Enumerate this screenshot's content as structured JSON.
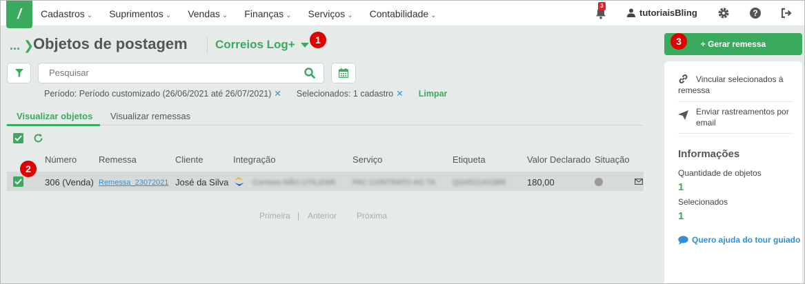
{
  "topbar": {
    "logo": "/",
    "menu": [
      "Cadastros",
      "Suprimentos",
      "Vendas",
      "Finanças",
      "Serviços",
      "Contabilidade"
    ],
    "notifications": "3",
    "user": "tutoriaisBling"
  },
  "page": {
    "crumb": "...",
    "title": "Objetos de postagem",
    "integration": "Correios Log+"
  },
  "callouts": [
    "1",
    "2",
    "3"
  ],
  "search": {
    "placeholder": "Pesquisar"
  },
  "filters": {
    "period": "Período: Período customizado (26/06/2021 até 26/07/2021)",
    "selected": "Selecionados: 1 cadastro",
    "clear": "Limpar",
    "remove": "✕"
  },
  "tabs": {
    "objects": "Visualizar objetos",
    "shipments": "Visualizar remessas"
  },
  "table": {
    "headers": [
      "Número",
      "Remessa",
      "Cliente",
      "Integração",
      "Serviço",
      "Etiqueta",
      "Valor Declarado",
      "Situação"
    ],
    "row": {
      "numero": "306 (Venda)",
      "remessa": "Remessa_23072021",
      "cliente": "José da Silva",
      "integracao": "Correios NÃO UTILIZAR",
      "servico": "PAC CONTRATO AG TA",
      "etiqueta": "QG0521XX2BR",
      "valor": "180,00"
    }
  },
  "pager": {
    "first": "Primeira",
    "sep": "|",
    "prev": "Anterior",
    "next": "Próxima"
  },
  "side": {
    "generate": "+ Gerar remessa",
    "link_line1": "Vincular selecionados à",
    "link_line2": "remessa",
    "send_line1": "Enviar rastreamentos por",
    "send_line2": "email",
    "info_title": "Informações",
    "qty_label": "Quantidade de objetos",
    "qty_value": "1",
    "sel_label": "Selecionados",
    "sel_value": "1",
    "tour": "Quero ajuda do tour guiado"
  },
  "colors": {
    "accent": "#3aaa5e",
    "link": "#2f8fd6",
    "callout": "#e00000"
  }
}
